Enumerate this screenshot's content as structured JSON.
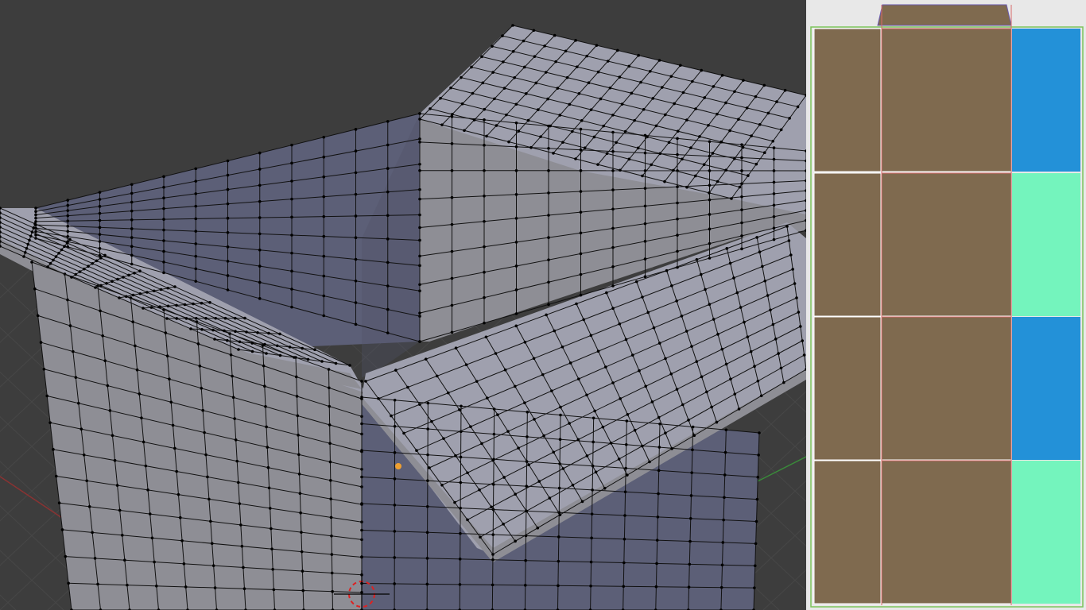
{
  "viewport": {
    "background": "#3d3d3d",
    "grid_color": "#474747",
    "axis_x_color": "#8a3232",
    "axis_y_color": "#3a8a3a",
    "face_light": "#9fa0ae",
    "face_side": "#8e8e95",
    "face_inner": "#5c5f77",
    "face_inner_shadow": "#4f5268",
    "edge_color": "#111111",
    "vertex_color": "#000000",
    "origin_color": "#f0a030",
    "cursor_colors": [
      "#d22",
      "#ffffff"
    ]
  },
  "uv_editor": {
    "background": "#e8e8e8",
    "island_color": "#7f6a4f",
    "boundary_color": "#ffffff",
    "outline_color": "#7cc45a",
    "seam_color": "#d86a6a",
    "swatches": [
      {
        "name": "blue",
        "color": "#2391d8"
      },
      {
        "name": "mint",
        "color": "#74f4bd"
      },
      {
        "name": "blue",
        "color": "#2391d8"
      },
      {
        "name": "mint",
        "color": "#74f4bd"
      }
    ]
  }
}
